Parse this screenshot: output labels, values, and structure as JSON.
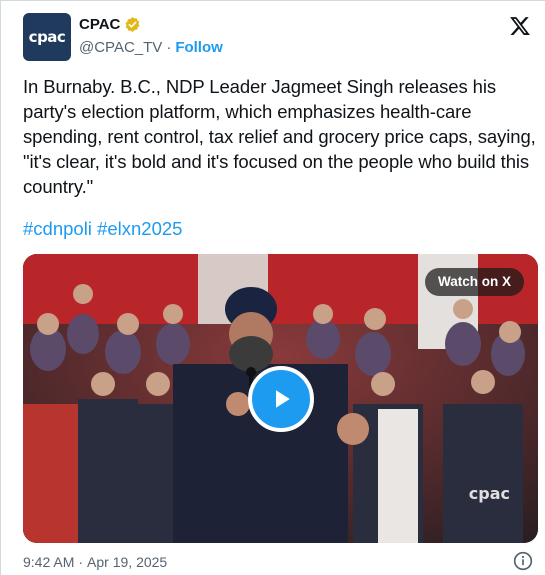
{
  "author": {
    "avatar_text": "cpac",
    "display_name": "CPAC",
    "handle": "@CPAC_TV",
    "separator": "·",
    "follow_label": "Follow"
  },
  "tweet": {
    "text": "In Burnaby. B.C., NDP Leader Jagmeet Singh releases his party's election platform, which emphasizes health-care spending, rent control, tax relief and grocery price caps, saying, \"it's clear, it's bold and it's focused on the people who build this country.\"",
    "hashtags": [
      "#cdnpoli",
      "#elxn2025"
    ]
  },
  "media": {
    "watch_label": "Watch on X",
    "watermark": "cpac",
    "video_state": "paused"
  },
  "footer": {
    "time": "9:42 AM",
    "separator": "·",
    "date": "Apr 19, 2025"
  },
  "icons": {
    "verified": "verified-badge-icon",
    "brand": "x-logo-icon",
    "play": "play-icon",
    "info": "info-icon"
  },
  "colors": {
    "accent": "#1d9bf0",
    "verified_gold": "#e2b719",
    "text_primary": "#0f1419",
    "text_secondary": "#536471"
  }
}
